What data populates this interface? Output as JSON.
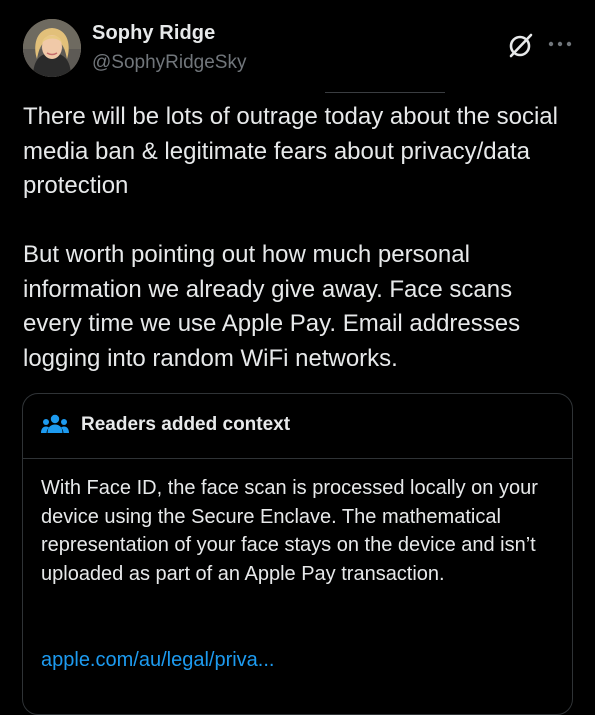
{
  "author": {
    "display_name": "Sophy Ridge",
    "handle": "@SophyRidgeSky",
    "avatar_icon": "avatar-photo"
  },
  "header_icons": {
    "grok": "slashed-circle-icon",
    "more": "more-icon"
  },
  "tweet": {
    "paragraphs": [
      "There will be lots of outrage today about the social media ban & legitimate fears about privacy/data protection",
      "But worth pointing out how much personal information we already give away. Face scans every time we use Apple Pay. Email addresses logging into random WiFi networks."
    ]
  },
  "community_note": {
    "title": "Readers added context",
    "icon": "people-icon",
    "body": "With Face ID, the face scan is processed locally on your device using the Secure Enclave. The mathematical representation of your face stays on the device and isn’t uploaded as part of an Apple Pay transaction.",
    "link_text": "apple.com/au/legal/priva..."
  },
  "colors": {
    "background": "#000000",
    "text_primary": "#e7e9ea",
    "text_secondary": "#71767b",
    "border": "#2f3336",
    "link": "#1d9bf0",
    "accent_icon": "#1d9bf0"
  }
}
